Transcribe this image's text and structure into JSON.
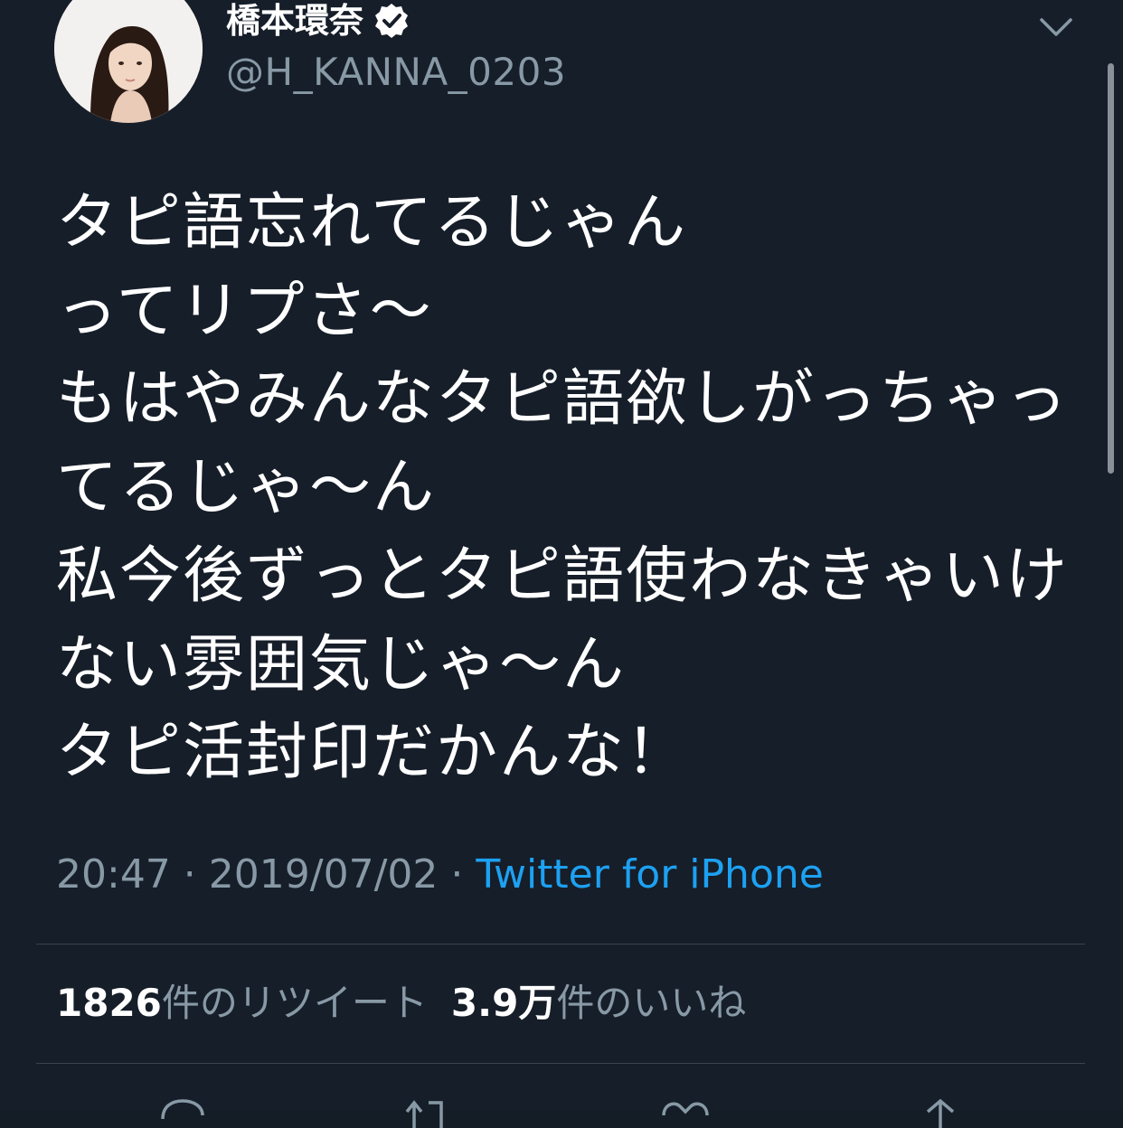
{
  "header": {
    "display_name": "橋本環奈",
    "handle": "@H_KANNA_0203"
  },
  "tweet": {
    "lines": [
      "タピ語忘れてるじゃん",
      "ってリプさ〜",
      "もはやみんなタピ語欲しがっちゃっ",
      "てるじゃ〜ん",
      "私今後ずっとタピ語使わなきゃいけ",
      "ない雰囲気じゃ〜ん",
      "タピ活封印だかんな！"
    ]
  },
  "meta": {
    "time": "20:47",
    "separator1": " · ",
    "date": "2019/07/02",
    "separator2": " · ",
    "source": "Twitter for iPhone"
  },
  "stats": {
    "retweet_count": "1826",
    "retweet_label": "件のリツイート",
    "like_count": "3.9万",
    "like_label": "件のいいね"
  },
  "icons": {
    "avatar": "profile-photo",
    "verified": "verified-badge-icon",
    "menu": "chevron-down-icon",
    "reply": "reply-icon",
    "retweet": "retweet-icon",
    "like": "heart-icon",
    "share": "share-icon"
  },
  "colors": {
    "background": "#161e29",
    "secondary_text": "#8899a6",
    "link": "#1da1f2",
    "divider": "#38444d"
  }
}
